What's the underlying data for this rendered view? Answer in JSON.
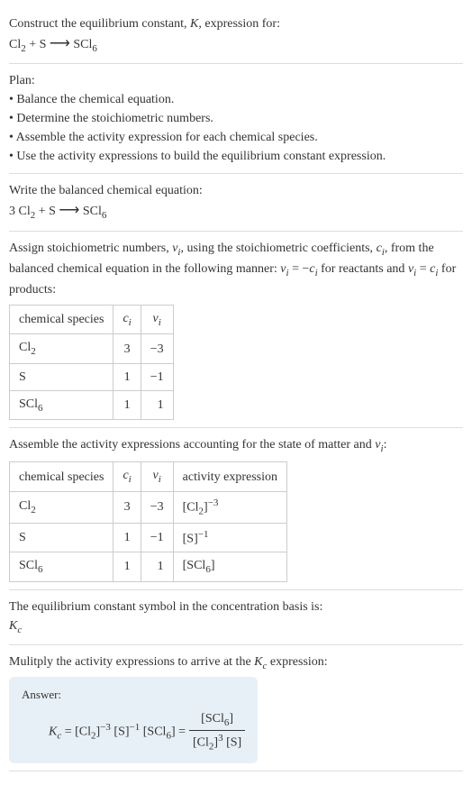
{
  "intro": {
    "line1": "Construct the equilibrium constant, ",
    "K": "K",
    "line1b": ", expression for:",
    "equation_lhs1": "Cl",
    "equation_sub1": "2",
    "equation_plus": " + S ",
    "equation_arrow": "⟶",
    "equation_rhs": " SCl",
    "equation_sub2": "6"
  },
  "plan": {
    "title": "Plan:",
    "b1": "• Balance the chemical equation.",
    "b2": "• Determine the stoichiometric numbers.",
    "b3": "• Assemble the activity expression for each chemical species.",
    "b4": "• Use the activity expressions to build the equilibrium constant expression."
  },
  "balanced": {
    "intro": "Write the balanced chemical equation:",
    "coef": "3 Cl",
    "sub1": "2",
    "mid": " + S ",
    "arrow": "⟶",
    "rhs": " SCl",
    "sub2": "6"
  },
  "assign": {
    "text1": "Assign stoichiometric numbers, ",
    "nu": "ν",
    "sub_i1": "i",
    "text2": ", using the stoichiometric coefficients, ",
    "c": "c",
    "sub_i2": "i",
    "text3": ", from the balanced chemical equation in the following manner: ",
    "nu2": "ν",
    "sub_i3": "i",
    "eq": " = −",
    "c2": "c",
    "sub_i4": "i",
    "text4": " for reactants and ",
    "nu3": "ν",
    "sub_i5": "i",
    "eq2": " = ",
    "c3": "c",
    "sub_i6": "i",
    "text5": " for products:"
  },
  "table1": {
    "h1": "chemical species",
    "h2_c": "c",
    "h2_i": "i",
    "h3_nu": "ν",
    "h3_i": "i",
    "r1_sp": "Cl",
    "r1_sub": "2",
    "r1_c": "3",
    "r1_nu": "−3",
    "r2_sp": "S",
    "r2_c": "1",
    "r2_nu": "−1",
    "r3_sp": "SCl",
    "r3_sub": "6",
    "r3_c": "1",
    "r3_nu": "1"
  },
  "assemble": {
    "text1": "Assemble the activity expressions accounting for the state of matter and ",
    "nu": "ν",
    "sub_i": "i",
    "text2": ":"
  },
  "table2": {
    "h1": "chemical species",
    "h2_c": "c",
    "h2_i": "i",
    "h3_nu": "ν",
    "h3_i": "i",
    "h4": "activity expression",
    "r1_sp": "Cl",
    "r1_sub": "2",
    "r1_c": "3",
    "r1_nu": "−3",
    "r1_act_l": "[Cl",
    "r1_act_sub": "2",
    "r1_act_r": "]",
    "r1_act_sup": "−3",
    "r2_sp": "S",
    "r2_c": "1",
    "r2_nu": "−1",
    "r2_act": "[S]",
    "r2_act_sup": "−1",
    "r3_sp": "SCl",
    "r3_sub": "6",
    "r3_c": "1",
    "r3_nu": "1",
    "r3_act": "[SCl",
    "r3_act_sub": "6",
    "r3_act_r": "]"
  },
  "symbol": {
    "text": "The equilibrium constant symbol in the concentration basis is:",
    "K": "K",
    "sub": "c"
  },
  "multiply": {
    "text1": "Mulitply the activity expressions to arrive at the ",
    "K": "K",
    "sub": "c",
    "text2": " expression:"
  },
  "answer": {
    "label": "Answer:",
    "K": "K",
    "Ksub": "c",
    "eq": " = [Cl",
    "sub1": "2",
    "br1": "]",
    "sup1": "−3",
    "sp": " [S]",
    "sup2": "−1",
    "scl": " [SCl",
    "sub2": "6",
    "br2": "] = ",
    "num_l": "[SCl",
    "num_sub": "6",
    "num_r": "]",
    "den_l": "[Cl",
    "den_sub": "2",
    "den_r": "]",
    "den_sup": "3",
    "den_s": " [S]"
  }
}
